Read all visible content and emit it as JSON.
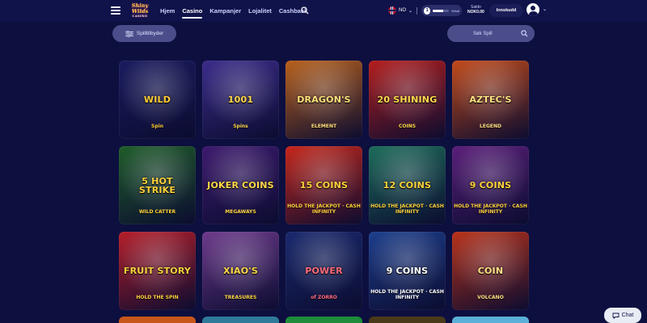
{
  "header": {
    "logo_text": "Shiny Wilds",
    "logo_sub": "CASINO",
    "nav": [
      "Hjem",
      "Casino",
      "Kampanjer",
      "Lojalitet",
      "Cashback"
    ],
    "active_nav": "Casino",
    "language": "NO",
    "level": {
      "number": "1",
      "progress": 0.65,
      "label": "Wisdi"
    },
    "balance_label": "Saldo",
    "balance_value": "NOK0.00",
    "deposit_label": "Innskudd"
  },
  "toolbar": {
    "filter_label": "Spilltilbyder",
    "search_placeholder": "Søk Spill"
  },
  "games": [
    {
      "title": "WILD",
      "sub": "Spin",
      "bg": "#1a1b5e",
      "color": "#ffcc33"
    },
    {
      "title": "1001",
      "sub": "Spins",
      "bg": "#3b2c8a",
      "color": "#ffd84a"
    },
    {
      "title": "DRAGON'S",
      "sub": "ELEMENT",
      "bg": "#b8611c",
      "color": "#ffe07a"
    },
    {
      "title": "20 SHINING",
      "sub": "COINS",
      "bg": "#b31e1e",
      "color": "#ffd94a"
    },
    {
      "title": "AZTEC'S",
      "sub": "LEGEND",
      "bg": "#c24a1a",
      "color": "#ffe082"
    },
    {
      "title": "5 HOT STRIKE",
      "sub": "WILD CATTER",
      "bg": "#1f5c2a",
      "color": "#ffd23c"
    },
    {
      "title": "JOKER COINS",
      "sub": "MEGAWAYS",
      "bg": "#3d1a6e",
      "color": "#ffd84a"
    },
    {
      "title": "15 COINS",
      "sub": "HOLD THE JACKPOT · CASH INFINITY",
      "bg": "#c6261a",
      "color": "#ffd23c"
    },
    {
      "title": "12 COINS",
      "sub": "HOLD THE JACKPOT · CASH INFINITY",
      "bg": "#1d6c5a",
      "color": "#ffd23c"
    },
    {
      "title": "9 COINS",
      "sub": "HOLD THE JACKPOT · CASH INFINITY",
      "bg": "#5a1e7a",
      "color": "#ffd23c"
    },
    {
      "title": "FRUIT STORY",
      "sub": "HOLD THE SPIN",
      "bg": "#b51e2a",
      "color": "#ffd23c"
    },
    {
      "title": "XIAO'S",
      "sub": "TREASURES",
      "bg": "#6d3a8c",
      "color": "#ffd84a"
    },
    {
      "title": "POWER",
      "sub": "of ZORRO",
      "bg": "#1a2a6e",
      "color": "#ff6b7d"
    },
    {
      "title": "9 COINS",
      "sub": "HOLD THE JACKPOT · CASH INFINITY",
      "bg": "#1d3e8c",
      "color": "#ffffff"
    },
    {
      "title": "COIN",
      "sub": "VOLCANO",
      "bg": "#b8321a",
      "color": "#ffe082"
    }
  ],
  "chat_label": "Chat"
}
